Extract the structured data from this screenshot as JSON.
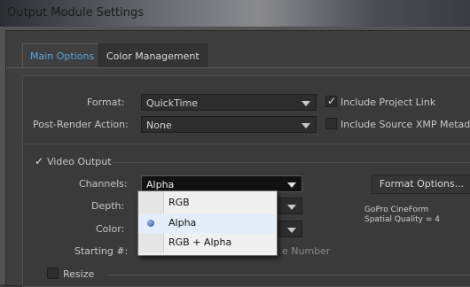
{
  "window": {
    "title": "Output Module Settings"
  },
  "tabs": [
    {
      "label": "Main Options"
    },
    {
      "label": "Color Management"
    }
  ],
  "main": {
    "format_label": "Format:",
    "format_value": "QuickTime",
    "post_render_label": "Post-Render Action:",
    "post_render_value": "None",
    "include_project_link_label": "Include Project Link",
    "include_project_link_checked": true,
    "include_xmp_label": "Include Source XMP Metadata",
    "include_xmp_checked": false
  },
  "video_output": {
    "label": "Video Output",
    "checked": true,
    "channels_label": "Channels:",
    "channels_value": "Alpha",
    "depth_label": "Depth:",
    "color_label": "Color:",
    "starting_label": "Starting #:",
    "use_comp_frame_number_partial": "e Number",
    "format_options_label": "Format Options...",
    "codec_line1": "GoPro CineForm",
    "codec_line2": "Spatial Quality = 4"
  },
  "channels_menu": {
    "options": [
      {
        "label": "RGB",
        "selected": false
      },
      {
        "label": "Alpha",
        "selected": true
      },
      {
        "label": "RGB + Alpha",
        "selected": false
      }
    ]
  },
  "resize": {
    "label": "Resize",
    "checked": false
  }
}
